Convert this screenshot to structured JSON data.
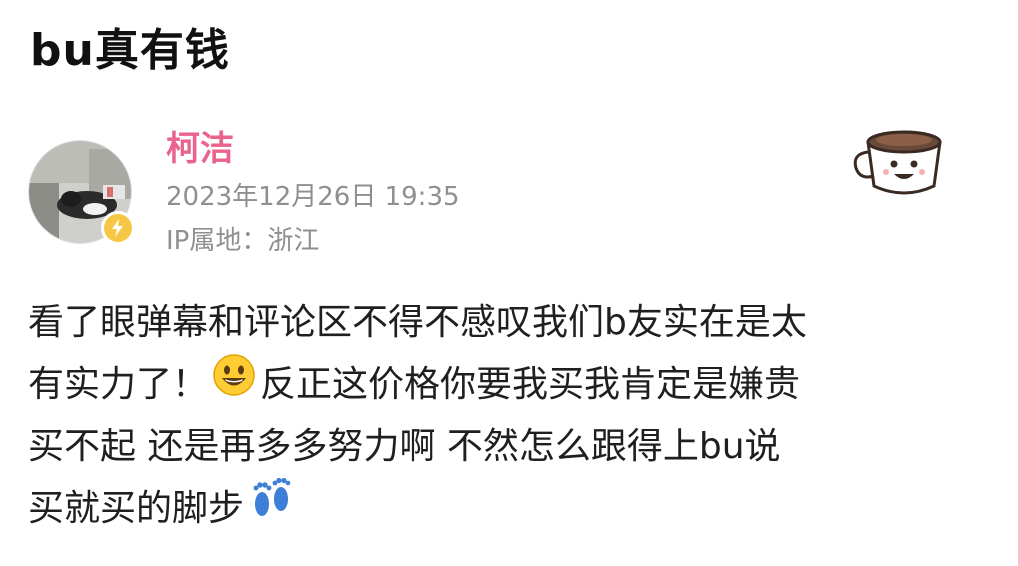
{
  "page": {
    "title": "bu真有钱"
  },
  "post": {
    "author": {
      "name": "柯洁",
      "badge_color": "#f6c744",
      "avatar_icon": "dog-photo-avatar"
    },
    "timestamp": "2023年12月26日 19:35",
    "ip_location": "IP属地：浙江",
    "body_lines": [
      "看了眼弹幕和评论区不得不感叹我们b友实在是太",
      "有实力了！",
      "反正这价格你要我买我肯定是嫌贵",
      "买不起 还是再多多努力啊 不然怎么跟得上bu说",
      "买就买的脚步"
    ],
    "emojis": {
      "grin": "grinning-face-emoji",
      "footprints": "footprints-emoji"
    }
  },
  "decor": {
    "sticker": "coffee-cup-sticker-icon"
  },
  "colors": {
    "username": "#e9638c",
    "meta_text": "#8f8f8f",
    "body_text": "#1f1f1f"
  }
}
